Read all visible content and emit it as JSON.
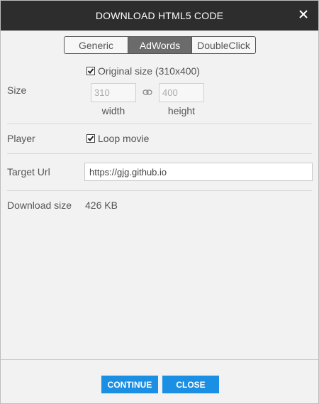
{
  "dialog": {
    "title": "DOWNLOAD HTML5 CODE",
    "close_icon": "close-icon"
  },
  "tabs": [
    {
      "label": "Generic",
      "selected": false
    },
    {
      "label": "AdWords",
      "selected": true
    },
    {
      "label": "DoubleClick",
      "selected": false
    }
  ],
  "size": {
    "label": "Size",
    "original_checkbox_label": "Original size (310x400)",
    "original_checked": true,
    "width_value": "310",
    "height_value": "400",
    "width_label": "width",
    "height_label": "height",
    "link_icon": "link-icon"
  },
  "player": {
    "label": "Player",
    "loop_label": "Loop movie",
    "loop_checked": true
  },
  "target_url": {
    "label": "Target Url",
    "value": "https://gjg.github.io"
  },
  "download_size": {
    "label": "Download size",
    "value": "426 KB"
  },
  "buttons": {
    "continue_label": "CONTINUE",
    "close_label": "CLOSE"
  },
  "colors": {
    "titlebar": "#2d2d2d",
    "tab_selected": "#6b6b6b",
    "button_primary": "#1a8fe3",
    "background": "#f2f2f2"
  }
}
